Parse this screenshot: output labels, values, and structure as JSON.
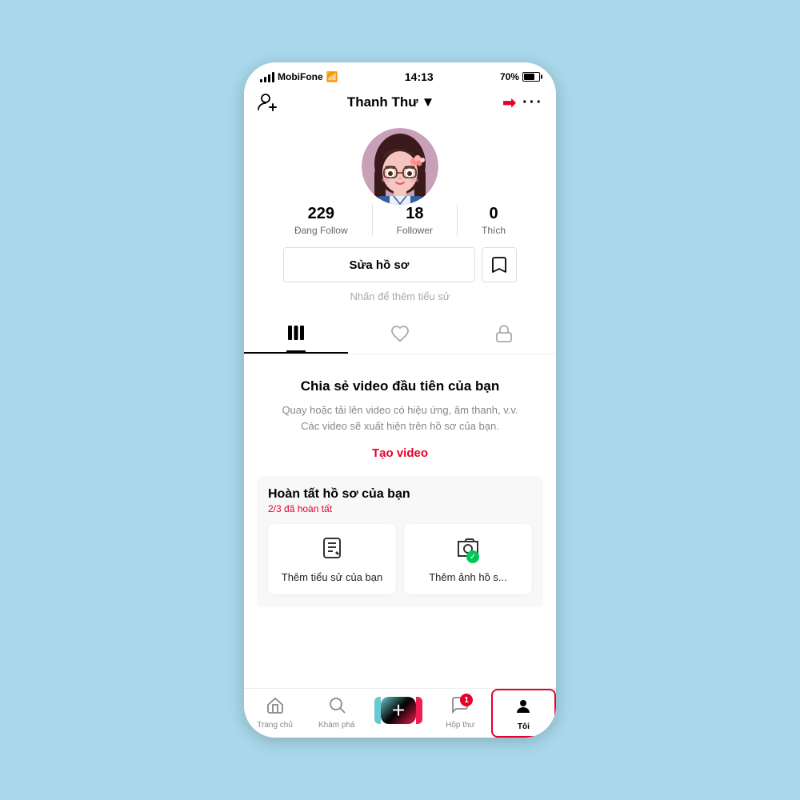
{
  "statusBar": {
    "carrier": "MobiFone",
    "time": "14:13",
    "battery": "70%"
  },
  "topNav": {
    "addUserLabel": "person+",
    "username": "Thanh Thư",
    "dropdownIcon": "▼",
    "arrowIcon": "→",
    "moreIcon": "···"
  },
  "profile": {
    "followingCount": "229",
    "followingLabel": "Đang Follow",
    "followerCount": "18",
    "followerLabel": "Follower",
    "likeCount": "0",
    "likeLabel": "Thích",
    "editButtonLabel": "Sửa hồ sơ",
    "bioHint": "Nhấn để thêm tiểu sử"
  },
  "tabs": {
    "videosLabel": "|||",
    "likedLabel": "♡",
    "privateLabel": "🔒"
  },
  "emptyState": {
    "title": "Chia sẻ video đầu tiên của bạn",
    "description": "Quay hoặc tải lên video có hiệu ứng, âm thanh, v.v. Các video sẽ xuất hiện trên hồ sơ của bạn.",
    "createButton": "Tạo video"
  },
  "completeProfile": {
    "title": "Hoàn tất hồ sơ của bạn",
    "subtitle": "2/3 đã hoàn tất",
    "card1Label": "Thêm tiểu sử của bạn",
    "card2Label": "Thêm ảnh hồ s..."
  },
  "bottomNav": {
    "homeLabel": "Trang chủ",
    "exploreLabel": "Khám phá",
    "inboxLabel": "Hộp thư",
    "profileLabel": "Tôi",
    "notificationCount": "1"
  }
}
